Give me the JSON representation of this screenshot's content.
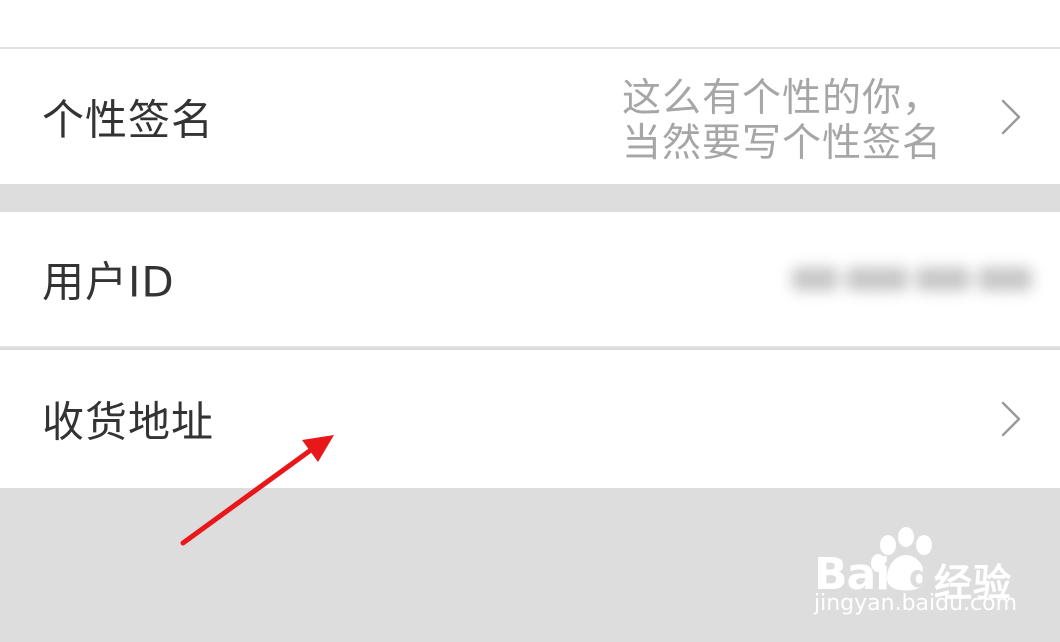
{
  "settings": {
    "signature": {
      "label": "个性签名",
      "value_line1": "这么有个性的你，",
      "value_line2": "当然要写个性签名",
      "icon": "chevron-right-icon"
    },
    "user_id": {
      "label": "用户ID"
    },
    "shipping_address": {
      "label": "收货地址",
      "icon": "chevron-right-icon"
    }
  },
  "annotation": {
    "color": "#e8181a",
    "icon": "red-arrow-icon"
  },
  "watermark": {
    "brand_bai": "Bai",
    "brand_du": "du",
    "brand_jingyan": "经验",
    "url": "jingyan.baidu.com",
    "icon": "baidu-paw-icon"
  },
  "colors": {
    "background": "#dddddd",
    "row_background": "#ffffff",
    "label_text": "#333333",
    "secondary_text": "#a6a6a6",
    "divider": "#e2e2e2"
  }
}
